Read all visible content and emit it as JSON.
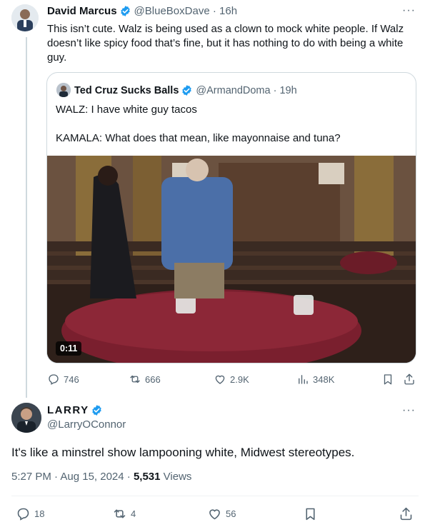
{
  "parent": {
    "name": "David Marcus",
    "handle": "@BlueBoxDave",
    "time": "16h",
    "text": "This isn’t cute. Walz is being used as a clown to mock white people. If Walz doesn’t like spicy food that’s fine, but it has nothing to do with being a white guy.",
    "more": "···"
  },
  "quote": {
    "name": "Ted Cruz Sucks Balls",
    "handle": "@ArmandDoma",
    "time": "19h",
    "line1": "WALZ: I have white guy tacos",
    "line2": "KAMALA: What does that mean, like mayonnaise and tuna?",
    "video_duration": "0:11"
  },
  "parent_actions": {
    "replies": "746",
    "reposts": "666",
    "likes": "2.9K",
    "views": "348K"
  },
  "main": {
    "name": "LARRY",
    "handle": "@LarryOConnor",
    "text": "It's like a minstrel show lampooning white, Midwest stereotypes.",
    "timestamp": "5:27 PM · Aug 15, 2024 · ",
    "views_count": "5,531",
    "views_label": " Views",
    "more": "···"
  },
  "main_actions": {
    "replies": "18",
    "reposts": "4",
    "likes": "56"
  },
  "colors": {
    "verified": "#1d9bf0",
    "muted": "#536471",
    "border": "#cfd9de"
  },
  "icons": [
    "reply-icon",
    "repost-icon",
    "like-icon",
    "views-icon",
    "bookmark-icon",
    "share-icon",
    "verified-badge-icon",
    "more-icon"
  ]
}
